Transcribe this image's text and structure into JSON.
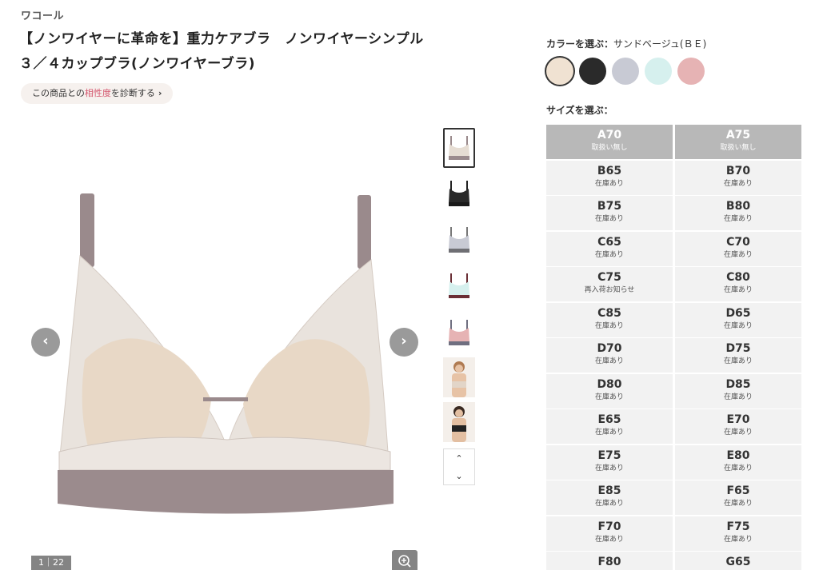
{
  "product": {
    "brand": "ワコール",
    "title_line1": "【ノンワイヤーに革命を】重力ケアブラ　ノンワイヤーシンプル",
    "title_line2": "３／４カップブラ(ノンワイヤーブラ)",
    "diagnose": {
      "prefix": "この商品との",
      "highlight": "相性度",
      "suffix": "を診断する",
      "chevron": "›"
    }
  },
  "gallery": {
    "prev_arrow": "‹",
    "next_arrow": "›",
    "counter": "1｜22",
    "thumb_up": "⌃",
    "thumb_down": "⌄",
    "thumbnails": [
      "bra-beige",
      "bra-black",
      "bra-gray",
      "bra-mint",
      "bra-pink",
      "model-beige",
      "model-black"
    ]
  },
  "color": {
    "label": "カラーを選ぶ：",
    "selected_name": "サンドベージュ(ＢＥ)",
    "swatches": [
      {
        "name": "sand-beige",
        "hex": "#f0e2d2",
        "selected": true
      },
      {
        "name": "black",
        "hex": "#2a2a2a",
        "selected": false
      },
      {
        "name": "gray",
        "hex": "#c8cad4",
        "selected": false
      },
      {
        "name": "mint",
        "hex": "#d6f0ee",
        "selected": false
      },
      {
        "name": "pink",
        "hex": "#e6b3b4",
        "selected": false
      }
    ]
  },
  "size": {
    "label": "サイズを選ぶ：",
    "cells": [
      {
        "size": "A70",
        "status": "取扱い無し",
        "available": false
      },
      {
        "size": "A75",
        "status": "取扱い無し",
        "available": false
      },
      {
        "size": "B65",
        "status": "在庫あり",
        "available": true
      },
      {
        "size": "B70",
        "status": "在庫あり",
        "available": true
      },
      {
        "size": "B75",
        "status": "在庫あり",
        "available": true
      },
      {
        "size": "B80",
        "status": "在庫あり",
        "available": true
      },
      {
        "size": "C65",
        "status": "在庫あり",
        "available": true
      },
      {
        "size": "C70",
        "status": "在庫あり",
        "available": true
      },
      {
        "size": "C75",
        "status": "再入荷お知らせ",
        "available": true
      },
      {
        "size": "C80",
        "status": "在庫あり",
        "available": true
      },
      {
        "size": "C85",
        "status": "在庫あり",
        "available": true
      },
      {
        "size": "D65",
        "status": "在庫あり",
        "available": true
      },
      {
        "size": "D70",
        "status": "在庫あり",
        "available": true
      },
      {
        "size": "D75",
        "status": "在庫あり",
        "available": true
      },
      {
        "size": "D80",
        "status": "在庫あり",
        "available": true
      },
      {
        "size": "D85",
        "status": "在庫あり",
        "available": true
      },
      {
        "size": "E65",
        "status": "在庫あり",
        "available": true
      },
      {
        "size": "E70",
        "status": "在庫あり",
        "available": true
      },
      {
        "size": "E75",
        "status": "在庫あり",
        "available": true
      },
      {
        "size": "E80",
        "status": "在庫あり",
        "available": true
      },
      {
        "size": "E85",
        "status": "在庫あり",
        "available": true
      },
      {
        "size": "F65",
        "status": "在庫あり",
        "available": true
      },
      {
        "size": "F70",
        "status": "在庫あり",
        "available": true
      },
      {
        "size": "F75",
        "status": "在庫あり",
        "available": true
      },
      {
        "size": "F80",
        "status": "",
        "available": true
      },
      {
        "size": "G65",
        "status": "",
        "available": true
      }
    ]
  }
}
